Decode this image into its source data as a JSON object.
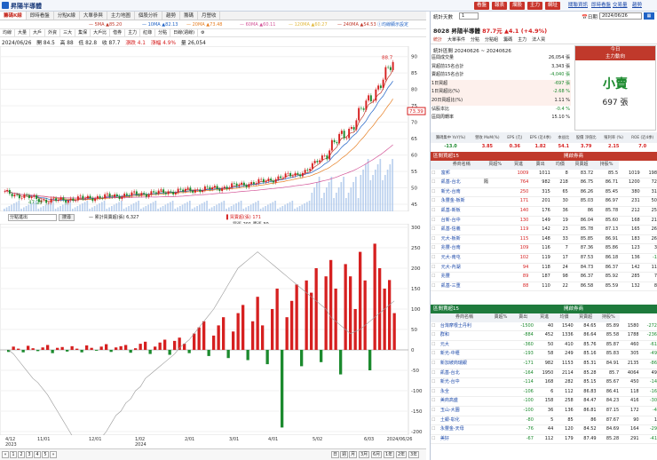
{
  "app": {
    "title": "昇陽半導體"
  },
  "top_buttons": [
    "看盤",
    "報表",
    "爛股",
    "主力",
    "網址"
  ],
  "top_links": [
    "關聯資訊",
    "即時看盤",
    "交易量",
    "趨勢",
    "外資",
    "動盪區"
  ],
  "tabs": [
    "籌碼K線",
    "即時看盤",
    "分點K線",
    "大單參與",
    "主力地圖",
    "個股分析",
    "趨勢",
    "籌碼",
    "月營收"
  ],
  "ma_legend": [
    {
      "label": "5MA",
      "value": "▲85.20",
      "color": "#c0392b"
    },
    {
      "label": "10MA",
      "value": "▲82.13",
      "color": "#1f62c5"
    },
    {
      "label": "20MA",
      "value": "▲73.48",
      "color": "#e67e22"
    },
    {
      "label": "60MA",
      "value": "▲60.11",
      "color": "#d35497"
    },
    {
      "label": "120MA",
      "value": "▲60.27",
      "color": "#e1b83c"
    },
    {
      "label": "240MA",
      "value": "▲54.53",
      "color": "#c0392b"
    }
  ],
  "ma_note": "Ⓘ均線顯示設定",
  "toolbar": [
    "均線",
    "大量",
    "大戶",
    "外資",
    "三大",
    "集保",
    "大戶比",
    "借券",
    "主力",
    "紅綠",
    "分點",
    "日線(週線)"
  ],
  "stock_info": {
    "date": "2024/06/26",
    "open": "開 84.5",
    "high": "高 88",
    "low": "低 82.8",
    "close": "收 87.7",
    "change": "漲跌 4.1",
    "pct": "漲幅 4.9%",
    "volume": "量 26,054"
  },
  "price_labels": {
    "y_top": "90",
    "high_tag": "88.7",
    "last_tag": "73.39",
    "low_tag": "47.29"
  },
  "price_axis": [
    "90",
    "85",
    "80",
    "75",
    "70",
    "65",
    "60",
    "55",
    "50",
    "45"
  ],
  "lower_axis": [
    "300",
    "250",
    "200",
    "150",
    "100",
    "50",
    "0",
    "-50",
    "-100",
    "-150",
    "-200"
  ],
  "position_select": "分點進出",
  "position_btn": "搜尋",
  "cum_legend": "— 累計買賣超(張) 6,327",
  "bar_legend": "▌買賣超(張) 171",
  "bar_sub": "買張 201 賣張 30",
  "date_axis": [
    "4/12\n2023",
    "11/01",
    "12/01",
    "1/02\n2024",
    "2/01",
    "3/01",
    "4/01",
    "5/02",
    "6/03",
    "2024/06/26"
  ],
  "pager": [
    "1",
    "2",
    "3",
    "4",
    "5"
  ],
  "periods": [
    "日",
    "週",
    "月",
    "3月",
    "6月",
    "1年",
    "2年",
    "3年",
    "5年"
  ],
  "rpanel": {
    "sort_label": "統計天數",
    "sort_value": "1",
    "date_label": "📅日期",
    "date_value": "2024/06/26",
    "stock_line": "8028 昇陽半導體",
    "price": "87.7元",
    "change": "▲4.1 (+4.9%)",
    "subtabs": [
      "統計",
      "大單事件",
      "分點",
      "分點組",
      "籌碼",
      "主力",
      "法人買"
    ],
    "period_label": "統計區間 20240626 ~ 20240626",
    "stats": [
      {
        "k": "區間成交量",
        "v": "26,054 張"
      },
      {
        "k": "買超前15名合計",
        "v": "3,343 張"
      },
      {
        "k": "賣超前15名合計",
        "v": "-4,040 張"
      },
      {
        "k": "1日買超",
        "v": "-697 張"
      },
      {
        "k": "1日買超比(%)",
        "v": "-2.68 %"
      },
      {
        "k": "20日買超比(%)",
        "v": "1.11 %"
      },
      {
        "k": "佔股本比",
        "v": "-0.4 %"
      },
      {
        "k": "區間周轉率",
        "v": "15.10 %"
      }
    ],
    "today_head": "今日",
    "today_sub": "主力動向",
    "today_verdict": "小賣",
    "today_amount": "697 張",
    "metrics_heads": [
      "籌碼集中\nYoY(%)",
      "營收\nMoM(%)",
      "EPS\n(元)",
      "EPS\n(近4季)",
      "本益比",
      "股價\n淨值比",
      "殖利率\n(%)",
      "ROE\n(近4季)"
    ],
    "metrics_vals": [
      "-13.0",
      "3.85",
      "0.36",
      "1.82",
      "54.1",
      "3.79",
      "2.15",
      "7.0"
    ],
    "buy_head": "區間買超15",
    "buy_ctrl": "開啟券商",
    "buy_cols": [
      "券商名稱",
      "買超%",
      "買進",
      "賣出",
      "均價",
      "買賣超",
      "持股%"
    ],
    "buy_rows": [
      [
        "富邦",
        "",
        "1009",
        "1011",
        "8",
        "83.72",
        "85.5",
        "1019",
        "198"
      ],
      [
        "凱基-台北",
        "隔",
        "764",
        "982",
        "218",
        "86.75",
        "86.71",
        "1200",
        "72"
      ],
      [
        "新光-台南",
        "",
        "250",
        "315",
        "65",
        "86.26",
        "85.45",
        "380",
        "31"
      ],
      [
        "永豐金-板新",
        "",
        "171",
        "201",
        "30",
        "85.03",
        "86.97",
        "231",
        "50"
      ],
      [
        "凱基-新板",
        "",
        "140",
        "176",
        "36",
        "86",
        "85.78",
        "212",
        "25"
      ],
      [
        "台新-台中",
        "",
        "130",
        "149",
        "19",
        "86.04",
        "85.60",
        "168",
        "21"
      ],
      [
        "凱基-信義",
        "",
        "119",
        "142",
        "23",
        "85.78",
        "87.13",
        "165",
        "26"
      ],
      [
        "元大-板新",
        "",
        "115",
        "148",
        "33",
        "85.85",
        "86.91",
        "183",
        "26"
      ],
      [
        "兆豐-台南",
        "",
        "109",
        "116",
        "7",
        "87.36",
        "85.86",
        "123",
        "3"
      ],
      [
        "元大-南屯",
        "",
        "102",
        "119",
        "17",
        "87.53",
        "86.18",
        "136",
        "-1"
      ],
      [
        "元大-內湖",
        "",
        "94",
        "118",
        "24",
        "84.73",
        "86.37",
        "142",
        "11"
      ],
      [
        "兆豐",
        "",
        "89",
        "187",
        "98",
        "86.37",
        "85.92",
        "285",
        "7"
      ],
      [
        "凱基-三重",
        "",
        "88",
        "110",
        "22",
        "86.58",
        "85.59",
        "132",
        "8"
      ]
    ],
    "sell_head": "區間賣超15",
    "sell_ctrl": "開啟券商",
    "sell_cols": [
      "券商名稱",
      "賣超%",
      "賣出",
      "買進",
      "均價",
      "買賣超",
      "持股%"
    ],
    "sell_rows": [
      [
        "台灣摩根士丹利",
        "",
        "-1500",
        "40",
        "1540",
        "84.65",
        "85.89",
        "1580",
        "-272"
      ],
      [
        "群和",
        "",
        "-884",
        "452",
        "1336",
        "86.64",
        "85.58",
        "1788",
        "-236"
      ],
      [
        "元大",
        "",
        "-360",
        "50",
        "410",
        "85.76",
        "85.87",
        "460",
        "-61"
      ],
      [
        "新光-中壢",
        "",
        "-193",
        "58",
        "249",
        "85.16",
        "85.83",
        "305",
        "-49"
      ],
      [
        "新加坡商瑞銀",
        "",
        "-171",
        "982",
        "1153",
        "85.31",
        "84.91",
        "2135",
        "-86"
      ],
      [
        "凱基-台北",
        "",
        "-164",
        "1950",
        "2114",
        "85.28",
        "85.7",
        "4064",
        "49"
      ],
      [
        "新光-台中",
        "",
        "-114",
        "168",
        "282",
        "85.15",
        "85.67",
        "450",
        "-14"
      ],
      [
        "永全",
        "",
        "-106",
        "6",
        "112",
        "86.83",
        "86.41",
        "118",
        "-16"
      ],
      [
        "美商高盛",
        "",
        "-100",
        "158",
        "258",
        "84.47",
        "84.23",
        "416",
        "-30"
      ],
      [
        "玉山-大園",
        "",
        "-100",
        "36",
        "136",
        "86.81",
        "87.15",
        "172",
        "-4"
      ],
      [
        "土銀-彰化",
        "",
        "-80",
        "5",
        "85",
        "86",
        "87.67",
        "90",
        "1"
      ],
      [
        "永豐金-天母",
        "",
        "-76",
        "44",
        "120",
        "84.52",
        "84.69",
        "164",
        "-29"
      ],
      [
        "美好",
        "",
        "-67",
        "112",
        "179",
        "87.49",
        "85.28",
        "291",
        "-41"
      ]
    ]
  },
  "chart_data": [
    {
      "type": "candlestick",
      "title": "",
      "xlabel": "",
      "ylabel": "",
      "ylim": [
        45,
        91
      ],
      "x": [
        "4/12",
        "11/01",
        "12/01",
        "1/02",
        "2/01",
        "3/01",
        "4/01",
        "5/02",
        "6/03",
        "6/26"
      ],
      "close": [
        48.5,
        46,
        47,
        48,
        49,
        50,
        52,
        55,
        68,
        87.7
      ],
      "high_mark": 88.7,
      "low_mark": 47.29
    },
    {
      "type": "bar",
      "title": "",
      "ylim": [
        -200,
        300
      ],
      "series": [
        {
          "name": "買賣超(張)",
          "values": [
            -5,
            8,
            3,
            -6,
            10,
            4,
            -3,
            6,
            12,
            -8,
            5,
            7,
            -4,
            9,
            3,
            -6,
            11,
            5,
            -2,
            8,
            14,
            -5,
            6,
            9,
            12,
            -7,
            4,
            15,
            20,
            -10,
            8,
            18,
            25,
            -12,
            22,
            30,
            15,
            -8,
            40,
            55,
            70,
            -15,
            35,
            60,
            80,
            -20,
            45,
            90,
            110,
            -25,
            70,
            130,
            60,
            -35,
            100,
            150,
            -190,
            80,
            120,
            160,
            -40,
            170,
            140,
            200,
            -30,
            180,
            220,
            150,
            -60,
            210,
            180,
            100,
            240,
            170,
            -50,
            260,
            200,
            150,
            171,
            90
          ]
        },
        {
          "name": "累計買賣超(張)",
          "values": [
            0,
            -10,
            -25,
            -40,
            -55,
            -70,
            -80,
            -95,
            -110,
            -130,
            -150,
            -170,
            -190,
            -210,
            -220,
            -230,
            -240,
            -250,
            -230,
            -215,
            -200,
            -180,
            -160,
            -150,
            -130,
            -120,
            -100,
            -90,
            -70,
            -60,
            -50,
            -40,
            -30,
            -20,
            -10,
            5,
            15,
            25,
            40,
            55,
            70,
            85,
            100,
            120,
            140,
            160,
            180,
            200,
            210,
            220,
            230,
            240,
            230,
            220,
            210,
            200,
            190,
            180,
            170,
            160,
            150,
            140,
            130,
            120,
            110,
            100,
            80,
            70,
            60,
            50,
            40,
            45,
            50,
            60,
            70,
            80,
            90,
            100,
            110,
            120
          ]
        }
      ]
    }
  ]
}
